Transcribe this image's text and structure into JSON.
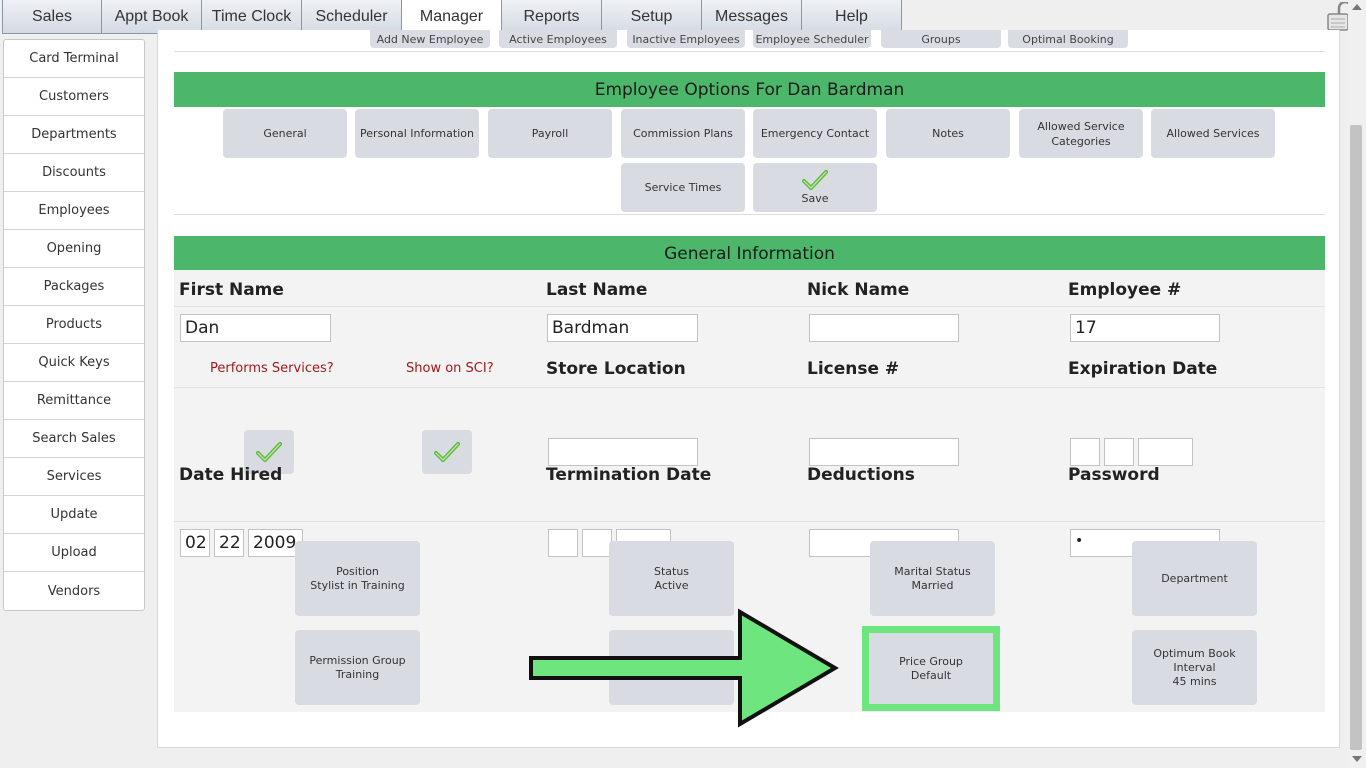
{
  "nav": {
    "tabs": [
      "Sales",
      "Appt Book",
      "Time Clock",
      "Scheduler",
      "Manager",
      "Reports",
      "Setup",
      "Messages",
      "Help"
    ],
    "active": "Manager"
  },
  "sidebar": {
    "items": [
      "Card Terminal",
      "Customers",
      "Departments",
      "Discounts",
      "Employees",
      "Opening",
      "Packages",
      "Products",
      "Quick Keys",
      "Remittance",
      "Search Sales",
      "Services",
      "Update",
      "Upload",
      "Vendors"
    ]
  },
  "subnav": {
    "items": [
      "Add New Employee",
      "Active Employees",
      "Inactive Employees",
      "Employee Scheduler",
      "Groups",
      "Optimal Booking"
    ]
  },
  "options": {
    "title": "Employee Options For Dan Bardman",
    "buttons": [
      "General",
      "Personal Information",
      "Payroll",
      "Commission Plans",
      "Emergency Contact",
      "Notes",
      "Allowed Service Categories",
      "Allowed Services"
    ],
    "service_times": "Service Times",
    "save": "Save"
  },
  "general": {
    "title": "General Information",
    "first_name_label": "First Name",
    "first_name": "Dan",
    "last_name_label": "Last Name",
    "last_name": "Bardman",
    "nick_name_label": "Nick Name",
    "nick_name": "",
    "employee_num_label": "Employee #",
    "employee_num": "17",
    "performs_services_label": "Performs Services?",
    "show_on_sci_label": "Show on SCI?",
    "store_location_label": "Store Location",
    "store_location": "",
    "license_label": "License #",
    "license": "",
    "expiration_label": "Expiration Date",
    "date_hired_label": "Date Hired",
    "date_hired": {
      "month": "02",
      "day": "22",
      "year": "2009"
    },
    "termination_label": "Termination Date",
    "deductions_label": "Deductions",
    "deductions": "",
    "password_label": "Password",
    "password": "•"
  },
  "fields": {
    "position": {
      "label": "Position",
      "value": "Stylist in Training"
    },
    "status": {
      "label": "Status",
      "value": "Active"
    },
    "marital": {
      "label": "Marital Status",
      "value": "Married"
    },
    "department": {
      "label": "Department"
    },
    "permission": {
      "label": "Permission Group",
      "value": "Training"
    },
    "price_group": {
      "label": "Price Group",
      "value": "Default"
    },
    "optimum": {
      "label": "Optimum Book",
      "label2": "Interval",
      "value": "45 mins"
    }
  },
  "colors": {
    "header_green": "#4cb66a",
    "highlight_green": "#6ee57f",
    "label_red": "#a0191d"
  }
}
